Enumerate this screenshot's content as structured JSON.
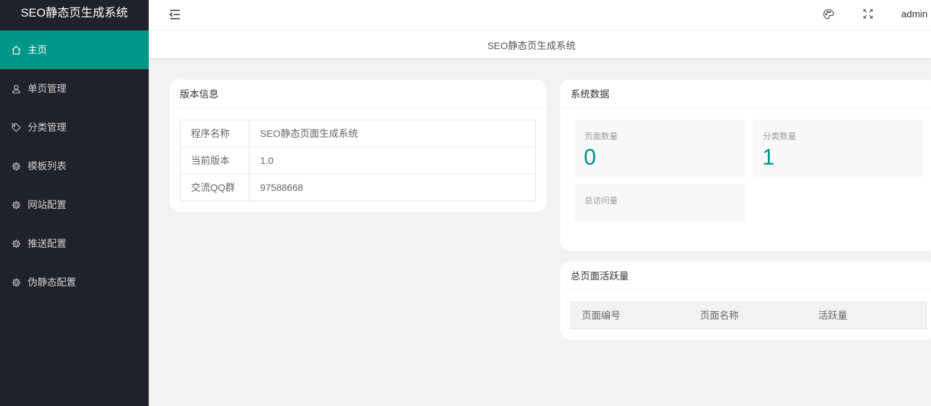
{
  "app": {
    "title": "SEO静态页生成系统"
  },
  "sidebar": {
    "items": [
      {
        "label": "主页",
        "icon": "home-icon",
        "active": true
      },
      {
        "label": "单页管理",
        "icon": "user-icon",
        "active": false
      },
      {
        "label": "分类管理",
        "icon": "tag-icon",
        "active": false
      },
      {
        "label": "模板列表",
        "icon": "gear-icon",
        "active": false
      },
      {
        "label": "网站配置",
        "icon": "gear-icon",
        "active": false
      },
      {
        "label": "推送配置",
        "icon": "gear-icon",
        "active": false
      },
      {
        "label": "伪静态配置",
        "icon": "gear-icon",
        "active": false
      }
    ]
  },
  "header": {
    "user": "admin"
  },
  "tab": {
    "title": "SEO静态页生成系统"
  },
  "version_card": {
    "title": "版本信息",
    "rows": [
      {
        "key": "程序名称",
        "value": "SEO静态页面生成系统"
      },
      {
        "key": "当前版本",
        "value": "1.0"
      },
      {
        "key": "交流QQ群",
        "value": "97588668"
      }
    ]
  },
  "system_card": {
    "title": "系统数据",
    "stats": [
      {
        "label": "页面数量",
        "value": "0"
      },
      {
        "label": "分类数量",
        "value": "1"
      },
      {
        "label": "总访问量",
        "value": ""
      }
    ]
  },
  "active_card": {
    "title": "总页面活跃量",
    "columns": [
      "页面编号",
      "页面名称",
      "活跃量"
    ]
  },
  "colors": {
    "accent": "#009688",
    "sidebar_bg": "#20222a"
  }
}
